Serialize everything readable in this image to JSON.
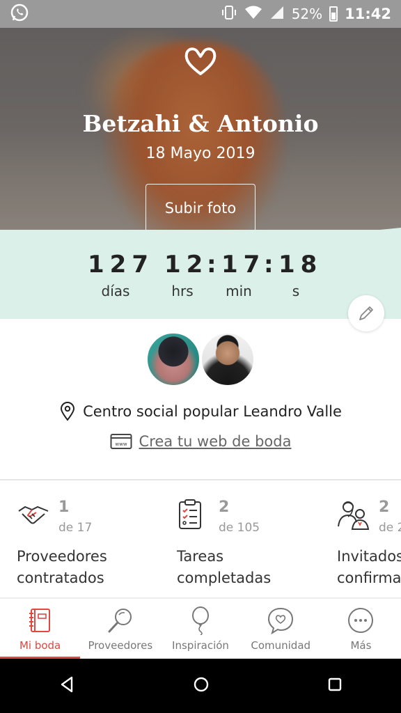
{
  "status_bar": {
    "battery": "52%",
    "time": "11:42",
    "icons": [
      "whatsapp-icon",
      "vibrate-icon",
      "wifi-icon",
      "signal-icon",
      "battery-icon"
    ]
  },
  "hero": {
    "title": "Betzahi & Antonio",
    "date": "18 Mayo 2019",
    "upload_label": "Subir foto"
  },
  "countdown": {
    "days": "127",
    "hours": "12",
    "minutes": "17",
    "seconds": "18",
    "sep": ":",
    "days_label": "días",
    "hours_label": "hrs",
    "minutes_label": "min",
    "seconds_label": "s"
  },
  "venue": {
    "name": "Centro social popular Leandro Valle",
    "web_link": "Crea tu web de boda"
  },
  "stats": [
    {
      "value": "1",
      "of": "de 17",
      "label_line1": "Proveedores",
      "label_line2": "contratados",
      "icon": "handshake-icon"
    },
    {
      "value": "2",
      "of": "de 105",
      "label_line1": "Tareas",
      "label_line2": "completadas",
      "icon": "checklist-icon"
    },
    {
      "value": "2",
      "of": "de 2",
      "label_line1": "Invitados",
      "label_line2": "confirma",
      "icon": "guests-icon"
    }
  ],
  "bottom_nav": [
    {
      "label": "Mi boda",
      "icon": "notebook-icon",
      "active": true
    },
    {
      "label": "Proveedores",
      "icon": "search-icon"
    },
    {
      "label": "Inspiración",
      "icon": "balloon-icon"
    },
    {
      "label": "Comunidad",
      "icon": "chat-heart-icon"
    },
    {
      "label": "Más",
      "icon": "more-icon"
    }
  ],
  "colors": {
    "accent": "#e0473f",
    "countdown_bg": "#dcf0ea",
    "status_bar": "#9a9a9a"
  }
}
